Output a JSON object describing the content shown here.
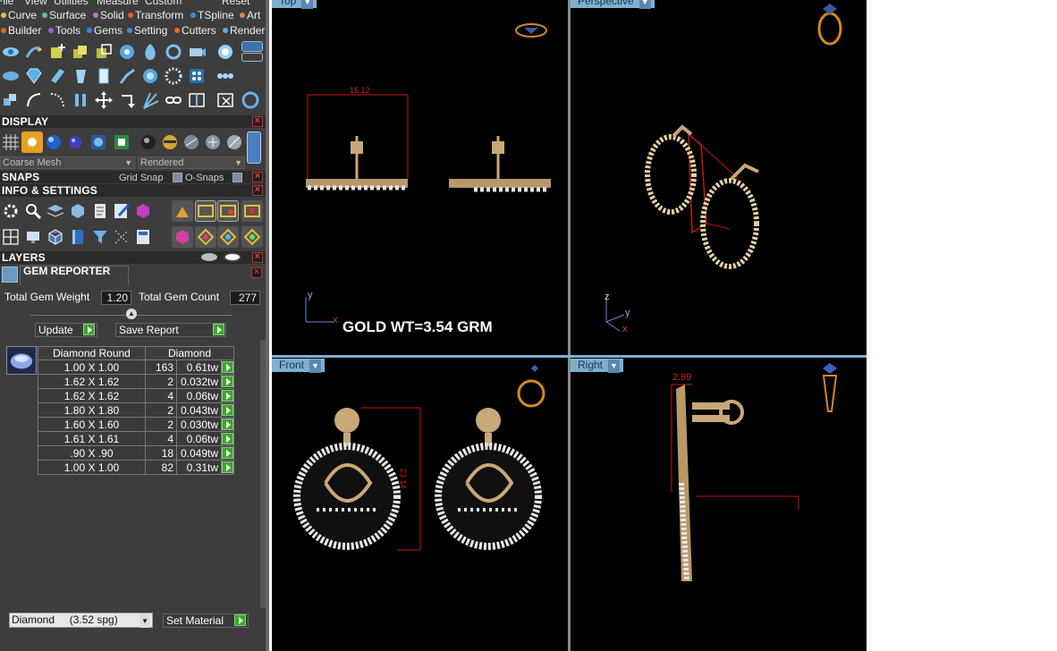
{
  "menubar": [
    "File",
    "View",
    "Utilities",
    "Measure",
    "Custom",
    "Reset"
  ],
  "tab_rows": [
    [
      {
        "label": "Curve",
        "color": "#d8c060"
      },
      {
        "label": "Surface",
        "color": "#60c0a0"
      },
      {
        "label": "Solid",
        "color": "#c070d0"
      },
      {
        "label": "Transform",
        "color": "#e06030"
      },
      {
        "label": "TSpline",
        "color": "#3090e0"
      },
      {
        "label": "Art",
        "color": "#e08040"
      }
    ],
    [
      {
        "label": "Builder",
        "color": "#d07030"
      },
      {
        "label": "Tools",
        "color": "#a060d0"
      },
      {
        "label": "Gems",
        "color": "#4080e0"
      },
      {
        "label": "Setting",
        "color": "#4090d0"
      },
      {
        "label": "Cutters",
        "color": "#e07020"
      },
      {
        "label": "Render",
        "color": "#60b0e0"
      }
    ]
  ],
  "panels": {
    "display": "DISPLAY",
    "mesh_mode": "Coarse Mesh",
    "render_mode": "Rendered",
    "snaps": "SNAPS",
    "grid_snap": "Grid Snap",
    "o_snaps": "O-Snaps",
    "info": "INFO & SETTINGS",
    "layers": "LAYERS",
    "gem_reporter": "GEM REPORTER"
  },
  "gem_reporter": {
    "total_weight_label": "Total Gem Weight",
    "total_weight": "1.20",
    "total_count_label": "Total Gem Count",
    "total_count": "277",
    "update": "Update",
    "save_report": "Save Report",
    "headers": [
      "Diamond Round",
      "Diamond"
    ],
    "rows": [
      {
        "size": "1.00 X 1.00",
        "count": "163",
        "weight": "0.61tw"
      },
      {
        "size": "1.62 X 1.62",
        "count": "2",
        "weight": "0.032tw"
      },
      {
        "size": "1.62 X 1.62",
        "count": "4",
        "weight": "0.06tw"
      },
      {
        "size": "1.80 X 1.80",
        "count": "2",
        "weight": "0.043tw"
      },
      {
        "size": "1.60 X 1.60",
        "count": "2",
        "weight": "0.030tw"
      },
      {
        "size": "1.61 X 1.61",
        "count": "4",
        "weight": "0.06tw"
      },
      {
        "size": ".90 X .90",
        "count": "18",
        "weight": "0.049tw"
      },
      {
        "size": "1.00 X 1.00",
        "count": "82",
        "weight": "0.31tw"
      }
    ],
    "material": "Diamond     (3.52 spg)",
    "set_material": "Set Material"
  },
  "viewports": {
    "top": {
      "label": "Top",
      "dimension": "16.12",
      "gold_weight": "GOLD WT=3.54 GRM",
      "axis_x": "x",
      "axis_y": "y"
    },
    "perspective": {
      "label": "Perspective",
      "axis_x": "x",
      "axis_y": "y",
      "axis_z": "z"
    },
    "front": {
      "label": "Front",
      "dimension": "23.14"
    },
    "right": {
      "label": "Right",
      "dimension": "2.89"
    }
  },
  "colors": {
    "viewport_tab": "#7faecf",
    "gold": "#c8a878",
    "dimension": "#d01818"
  }
}
